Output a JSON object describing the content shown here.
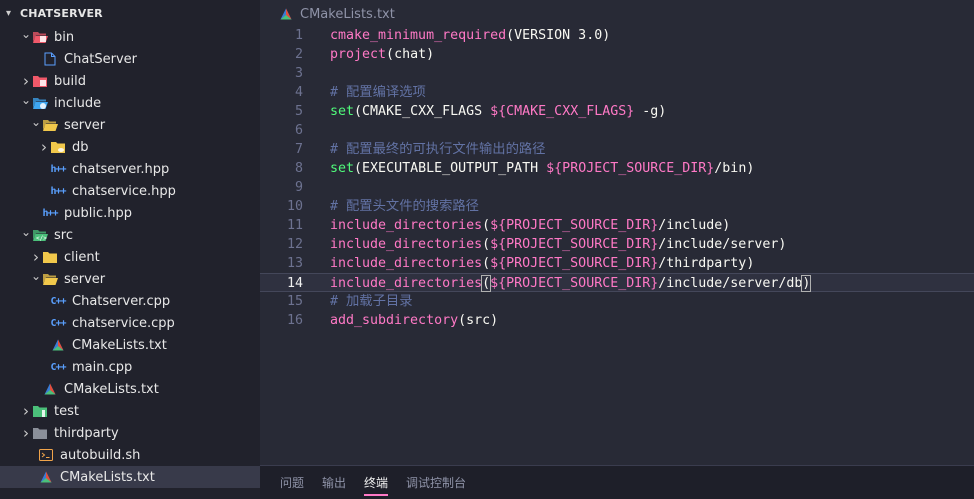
{
  "sidebar": {
    "title": "CHATSERVER",
    "items": [
      {
        "label": "bin",
        "type": "folder",
        "icon": "bin-folder-icon",
        "color": "#f0596a",
        "depth": 0,
        "state": "open"
      },
      {
        "label": "ChatServer",
        "type": "file",
        "icon": "file-icon",
        "color": "#5aa0ff",
        "depth": 1,
        "state": "none"
      },
      {
        "label": "build",
        "type": "folder",
        "icon": "build-folder-icon",
        "color": "#f0596a",
        "depth": 0,
        "state": "closed"
      },
      {
        "label": "include",
        "type": "folder",
        "icon": "include-folder-icon",
        "color": "#3ea6f0",
        "depth": 0,
        "state": "open"
      },
      {
        "label": "server",
        "type": "folder",
        "icon": "folder-icon",
        "color": "#f1c84b",
        "depth": 1,
        "state": "open"
      },
      {
        "label": "db",
        "type": "folder",
        "icon": "db-folder-icon",
        "color": "#f1c84b",
        "depth": 2,
        "state": "closed"
      },
      {
        "label": "chatserver.hpp",
        "type": "hpp",
        "icon": "hpp-file-icon",
        "color": "#5aa0ff",
        "depth": 2,
        "state": "none"
      },
      {
        "label": "chatservice.hpp",
        "type": "hpp",
        "icon": "hpp-file-icon",
        "color": "#5aa0ff",
        "depth": 2,
        "state": "none"
      },
      {
        "label": "public.hpp",
        "type": "hpp",
        "icon": "hpp-file-icon",
        "color": "#5aa0ff",
        "depth": 1,
        "state": "none"
      },
      {
        "label": "src",
        "type": "folder",
        "icon": "src-folder-icon",
        "color": "#4bc07a",
        "depth": 0,
        "state": "open"
      },
      {
        "label": "client",
        "type": "folder",
        "icon": "folder-icon",
        "color": "#f1c84b",
        "depth": 1,
        "state": "closed"
      },
      {
        "label": "server",
        "type": "folder",
        "icon": "folder-icon",
        "color": "#f1c84b",
        "depth": 1,
        "state": "open"
      },
      {
        "label": "Chatserver.cpp",
        "type": "cpp",
        "icon": "cpp-file-icon",
        "color": "#5aa0ff",
        "depth": 2,
        "state": "none"
      },
      {
        "label": "chatservice.cpp",
        "type": "cpp",
        "icon": "cpp-file-icon",
        "color": "#5aa0ff",
        "depth": 2,
        "state": "none"
      },
      {
        "label": "CMakeLists.txt",
        "type": "cmake",
        "icon": "cmake-file-icon",
        "color": "#e44d3a",
        "depth": 2,
        "state": "none"
      },
      {
        "label": "main.cpp",
        "type": "cpp",
        "icon": "cpp-file-icon",
        "color": "#5aa0ff",
        "depth": 2,
        "state": "none"
      },
      {
        "label": "CMakeLists.txt",
        "type": "cmake",
        "icon": "cmake-file-icon",
        "color": "#e44d3a",
        "depth": 1,
        "state": "none"
      },
      {
        "label": "test",
        "type": "folder",
        "icon": "test-folder-icon",
        "color": "#4bc07a",
        "depth": 0,
        "state": "closed"
      },
      {
        "label": "thirdparty",
        "type": "folder",
        "icon": "folder-icon",
        "color": "#8a8f99",
        "depth": 0,
        "state": "closed"
      },
      {
        "label": "autobuild.sh",
        "type": "shell",
        "icon": "shell-file-icon",
        "color": "#f0a44b",
        "depth": 0,
        "state": "none"
      },
      {
        "label": "CMakeLists.txt",
        "type": "cmake",
        "icon": "cmake-file-icon",
        "color": "#e44d3a",
        "depth": 0,
        "state": "none",
        "selected": true
      }
    ]
  },
  "editor": {
    "tab_label": "CMakeLists.txt",
    "current_line": 14,
    "lines": [
      {
        "n": "1",
        "text": "cmake_minimum_required(VERSION 3.0)"
      },
      {
        "n": "2",
        "text": "project(chat)"
      },
      {
        "n": "3",
        "text": ""
      },
      {
        "n": "4",
        "text": "# 配置编译选项"
      },
      {
        "n": "5",
        "text": "set(CMAKE_CXX_FLAGS ${CMAKE_CXX_FLAGS} -g)"
      },
      {
        "n": "6",
        "text": ""
      },
      {
        "n": "7",
        "text": "# 配置最终的可执行文件输出的路径"
      },
      {
        "n": "8",
        "text": "set(EXECUTABLE_OUTPUT_PATH ${PROJECT_SOURCE_DIR}/bin)"
      },
      {
        "n": "9",
        "text": ""
      },
      {
        "n": "10",
        "text": "# 配置头文件的搜索路径"
      },
      {
        "n": "11",
        "text": "include_directories(${PROJECT_SOURCE_DIR}/include)"
      },
      {
        "n": "12",
        "text": "include_directories(${PROJECT_SOURCE_DIR}/include/server)"
      },
      {
        "n": "13",
        "text": "include_directories(${PROJECT_SOURCE_DIR}/thirdparty)"
      },
      {
        "n": "14",
        "text": "include_directories(${PROJECT_SOURCE_DIR}/include/server/db)"
      },
      {
        "n": "15",
        "text": "# 加载子目录"
      },
      {
        "n": "16",
        "text": "add_subdirectory(src)"
      }
    ]
  },
  "panel": {
    "tabs": [
      {
        "label": "问题",
        "active": false
      },
      {
        "label": "输出",
        "active": false
      },
      {
        "label": "终端",
        "active": true
      },
      {
        "label": "调试控制台",
        "active": false
      }
    ]
  },
  "colors": {
    "keyword": "#50fa7b",
    "variable": "#ff79c6",
    "comment": "#6272a4",
    "text": "#f8f8f2"
  }
}
